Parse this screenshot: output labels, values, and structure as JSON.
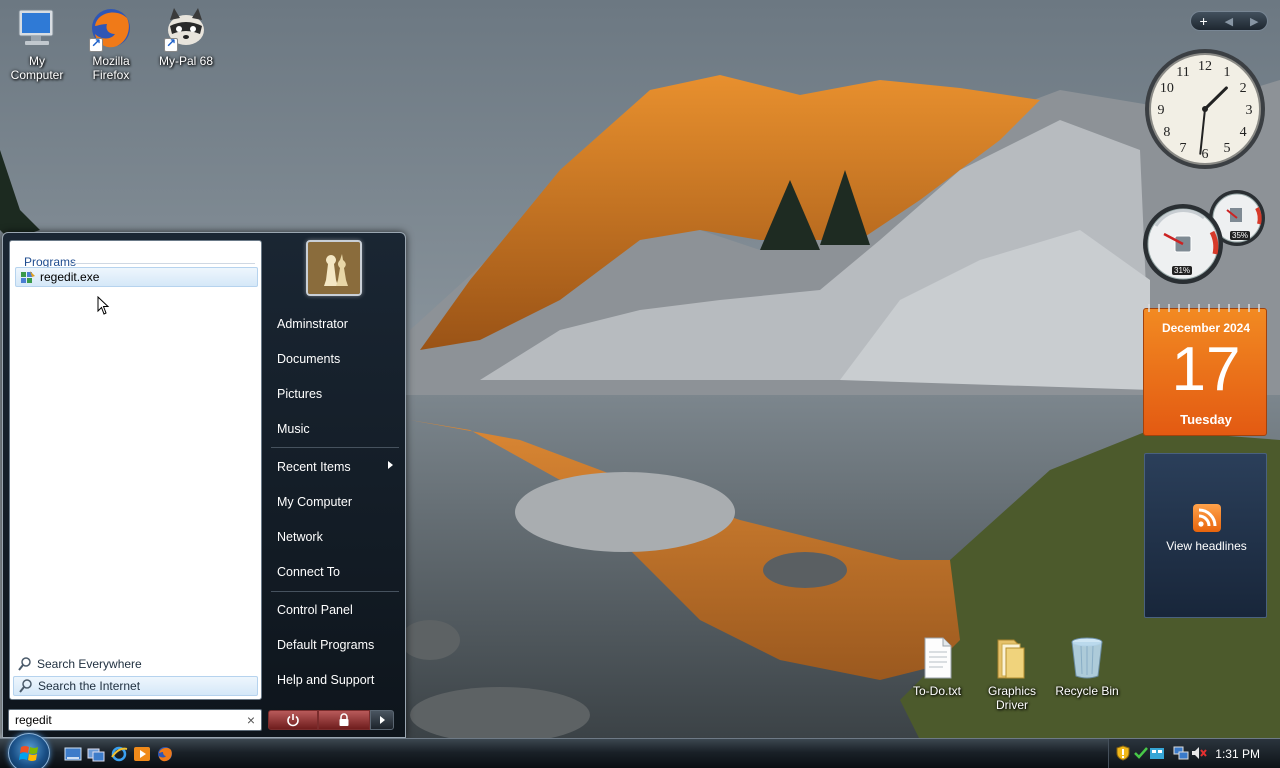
{
  "desktop": {
    "icons": [
      {
        "label": "My\nComputer",
        "line1": "My",
        "line2": "Computer"
      },
      {
        "label": "Mozilla Firefox",
        "line1": "Mozilla",
        "line2": "Firefox"
      },
      {
        "label": "My-Pal 68",
        "line1": "My-Pal 68",
        "line2": ""
      },
      {
        "label": "To-Do.txt",
        "line1": "To-Do.txt",
        "line2": ""
      },
      {
        "label": "Graphics Driver",
        "line1": "Graphics",
        "line2": "Driver"
      },
      {
        "label": "Recycle Bin",
        "line1": "Recycle Bin",
        "line2": ""
      }
    ]
  },
  "start_menu": {
    "programs_heading": "Programs",
    "results": [
      "regedit.exe"
    ],
    "search_everywhere": "Search Everywhere",
    "search_internet": "Search the Internet",
    "search_value": "regedit",
    "right_items": [
      "Adminstrator",
      "Documents",
      "Pictures",
      "Music",
      "Recent Items",
      "My Computer",
      "Network",
      "Connect To",
      "Control Panel",
      "Default Programs",
      "Help and Support"
    ]
  },
  "gadgets": {
    "clock": {
      "hour": 1,
      "minute": 31,
      "numerals": [
        "12",
        "1",
        "2",
        "3",
        "4",
        "5",
        "6",
        "7",
        "8",
        "9",
        "10",
        "11"
      ]
    },
    "cpu": {
      "cpu_percent": "31%",
      "memory_percent": "35%"
    },
    "calendar": {
      "month_year": "December 2024",
      "day": "17",
      "weekday": "Tuesday"
    },
    "feed": {
      "label": "View headlines"
    }
  },
  "taskbar": {
    "clock": "1:31 PM"
  },
  "colors": {
    "calendar": "#e8661a",
    "feed_bg": "#1f3049",
    "power_button": "#9a3a3a"
  }
}
